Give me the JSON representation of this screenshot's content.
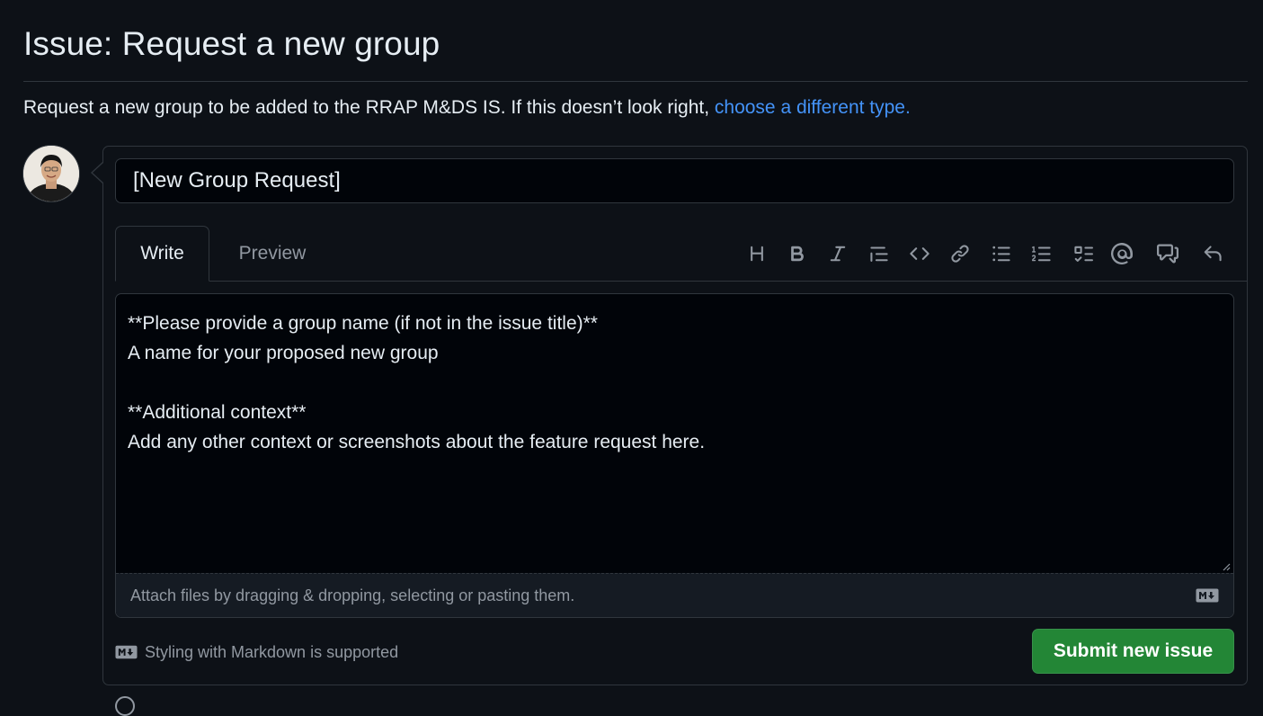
{
  "page": {
    "title": "Issue: Request a new group",
    "intro_text": "Request a new group to be added to the RRAP M&DS IS. If this doesn’t look right, ",
    "intro_link": "choose a different type."
  },
  "issue_form": {
    "title_value": "[New Group Request]",
    "tabs": [
      {
        "label": "Write",
        "active": true
      },
      {
        "label": "Preview",
        "active": false
      }
    ],
    "toolbar": [
      "heading-icon",
      "bold-icon",
      "italic-icon",
      "quote-icon",
      "code-icon",
      "link-icon",
      "unordered-list-icon",
      "ordered-list-icon",
      "task-list-icon",
      "mention-icon",
      "reference-icon",
      "undo-icon"
    ],
    "body_text": "**Please provide a group name (if not in the issue title)**\nA name for your proposed new group\n\n**Additional context**\nAdd any other context or screenshots about the feature request here.",
    "attach_hint": "Attach files by dragging & dropping, selecting or pasting them.",
    "markdown_note": "Styling with Markdown is supported",
    "submit_label": "Submit new issue"
  },
  "colors": {
    "background": "#0d1117",
    "border": "#30363d",
    "link": "#4493f8",
    "primary_button": "#238636",
    "muted_text": "#9198a1"
  }
}
